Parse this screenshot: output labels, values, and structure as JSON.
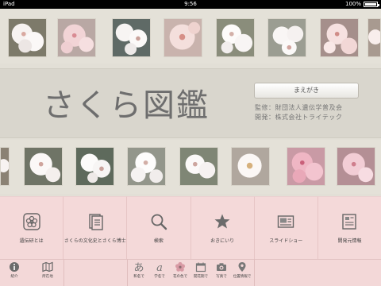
{
  "status_bar": {
    "carrier": "iPad",
    "time": "9:56",
    "battery": "100%"
  },
  "app": {
    "title": "さくら図鑑"
  },
  "intro_button": {
    "label": "まえがき"
  },
  "credits": {
    "supervisor": "監修：財団法人遺伝学普及会",
    "developer": "開発：株式会社トライテック"
  },
  "menu": {
    "items": [
      {
        "label": "遺伝研とは",
        "icon": "flower-badge-icon"
      },
      {
        "label": "さくらの文化史とさくら博士",
        "icon": "book-icon"
      },
      {
        "label": "検索",
        "icon": "search-icon"
      },
      {
        "label": "おきにいり",
        "icon": "star-icon"
      },
      {
        "label": "スライドショー",
        "icon": "slideshow-icon"
      },
      {
        "label": "開発元情報",
        "icon": "info-card-icon"
      }
    ]
  },
  "bottom_bar": {
    "left": [
      {
        "label": "紹介",
        "icon": "info-icon"
      },
      {
        "label": "所在地",
        "icon": "map-icon"
      }
    ],
    "center": [
      {
        "label": "和名で",
        "icon": "hiragana-a-icon"
      },
      {
        "label": "学名で",
        "icon": "latin-a-icon"
      },
      {
        "label": "花の色で",
        "icon": "flower-color-icon"
      },
      {
        "label": "開花期で",
        "icon": "calendar-icon"
      },
      {
        "label": "写真で",
        "icon": "camera-icon"
      },
      {
        "label": "位置情報で",
        "icon": "location-pin-icon"
      }
    ]
  },
  "colors": {
    "background": "#e2dfd6",
    "menu_pink": "#f4d9d9",
    "title_grey": "#6e6e6e"
  }
}
